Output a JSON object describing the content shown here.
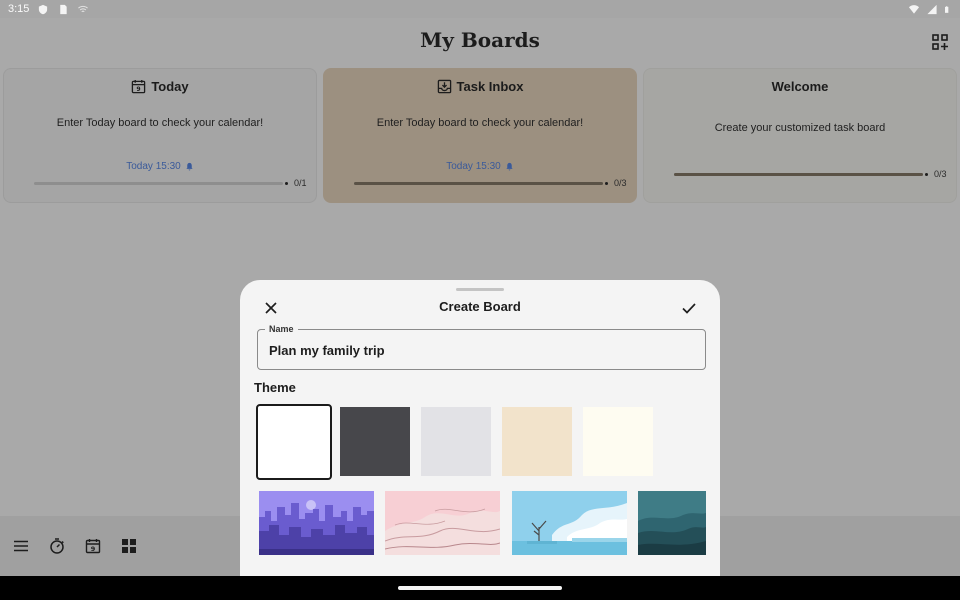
{
  "status_bar": {
    "time": "3:15"
  },
  "header": {
    "title": "My Boards"
  },
  "boards": [
    {
      "title": "Today",
      "icon": "calendar-icon",
      "description": "Enter Today board to check your calendar!",
      "due": "Today 15:30",
      "count": "0/1",
      "progress": 0
    },
    {
      "title": "Task Inbox",
      "icon": "inbox-icon",
      "description": "Enter Today board to check your calendar!",
      "due": "Today 15:30",
      "count": "0/3",
      "progress": 1
    },
    {
      "title": "Welcome",
      "icon": "",
      "description": "Create your customized task board",
      "due": "",
      "count": "0/3",
      "progress": 1
    }
  ],
  "bottom_bar": {
    "icons": [
      "menu-icon",
      "timer-icon",
      "calendar-icon",
      "grid-icon"
    ]
  },
  "sheet": {
    "title": "Create Board",
    "name_label": "Name",
    "name_value": "Plan my family trip",
    "theme_label": "Theme",
    "swatches": [
      "#ffffff",
      "#47474b",
      "#e2e2e6",
      "#f2e3cb",
      "#fefcf1"
    ],
    "selected_swatch": 0,
    "scenes": [
      "purple-city-scene",
      "pink-mountains-scene",
      "blue-sky-tree-scene",
      "teal-valley-scene"
    ]
  },
  "colors": {
    "accent_due": "#3a5a9a",
    "inbox_card": "#9c9080"
  }
}
